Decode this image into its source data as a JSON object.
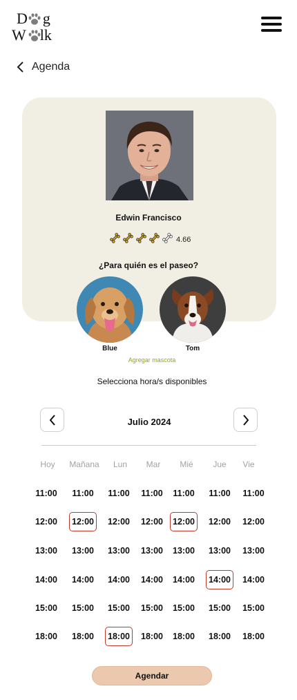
{
  "logo": {
    "line1_a": "D",
    "line1_b": "g",
    "line2_a": "W",
    "line2_b": "lk"
  },
  "header": {
    "back_label": "Agenda"
  },
  "walker": {
    "name": "Edwin Francisco",
    "rating_value": "4.66",
    "rating_bones": 5,
    "rating_filled": 4
  },
  "pets": {
    "question": "¿Para quién es el paseo?",
    "items": [
      {
        "name": "Blue"
      },
      {
        "name": "Tom"
      }
    ],
    "add_label": "Agregar mascota"
  },
  "schedule": {
    "instruction": "Selecciona hora/s disponibles",
    "month": "Julio 2024",
    "days": [
      {
        "label": "Hoy",
        "slots": [
          "11:00",
          "12:00",
          "13:00",
          "14:00",
          "15:00",
          "18:00"
        ],
        "selected": []
      },
      {
        "label": "Mañana",
        "slots": [
          "11:00",
          "12:00",
          "13:00",
          "14:00",
          "15:00",
          "18:00"
        ],
        "selected": [
          "12:00"
        ]
      },
      {
        "label": "Lun",
        "slots": [
          "11:00",
          "12:00",
          "13:00",
          "14:00",
          "15:00",
          "18:00"
        ],
        "selected": [
          "18:00"
        ]
      },
      {
        "label": "Mar",
        "slots": [
          "11:00",
          "12:00",
          "13:00",
          "14:00",
          "15:00",
          "18:00"
        ],
        "selected": []
      },
      {
        "label": "Mié",
        "slots": [
          "11:00",
          "12:00",
          "13:00",
          "14:00",
          "15:00",
          "18:00"
        ],
        "selected": [
          "12:00"
        ]
      },
      {
        "label": "Jue",
        "slots": [
          "11:00",
          "12:00",
          "13:00",
          "14:00",
          "15:00",
          "18:00"
        ],
        "selected": [
          "14:00"
        ]
      },
      {
        "label": "Vie",
        "slots": [
          "11:00",
          "12:00",
          "13:00",
          "14:00",
          "15:00",
          "18:00"
        ],
        "selected": []
      }
    ]
  },
  "actions": {
    "schedule_button": "Agendar"
  },
  "colors": {
    "card_bg": "#f1efe3",
    "accent": "#ecc9ae",
    "selected_border": "#c0392b",
    "link_green": "#8fa71a",
    "bone": "#c9a227"
  }
}
